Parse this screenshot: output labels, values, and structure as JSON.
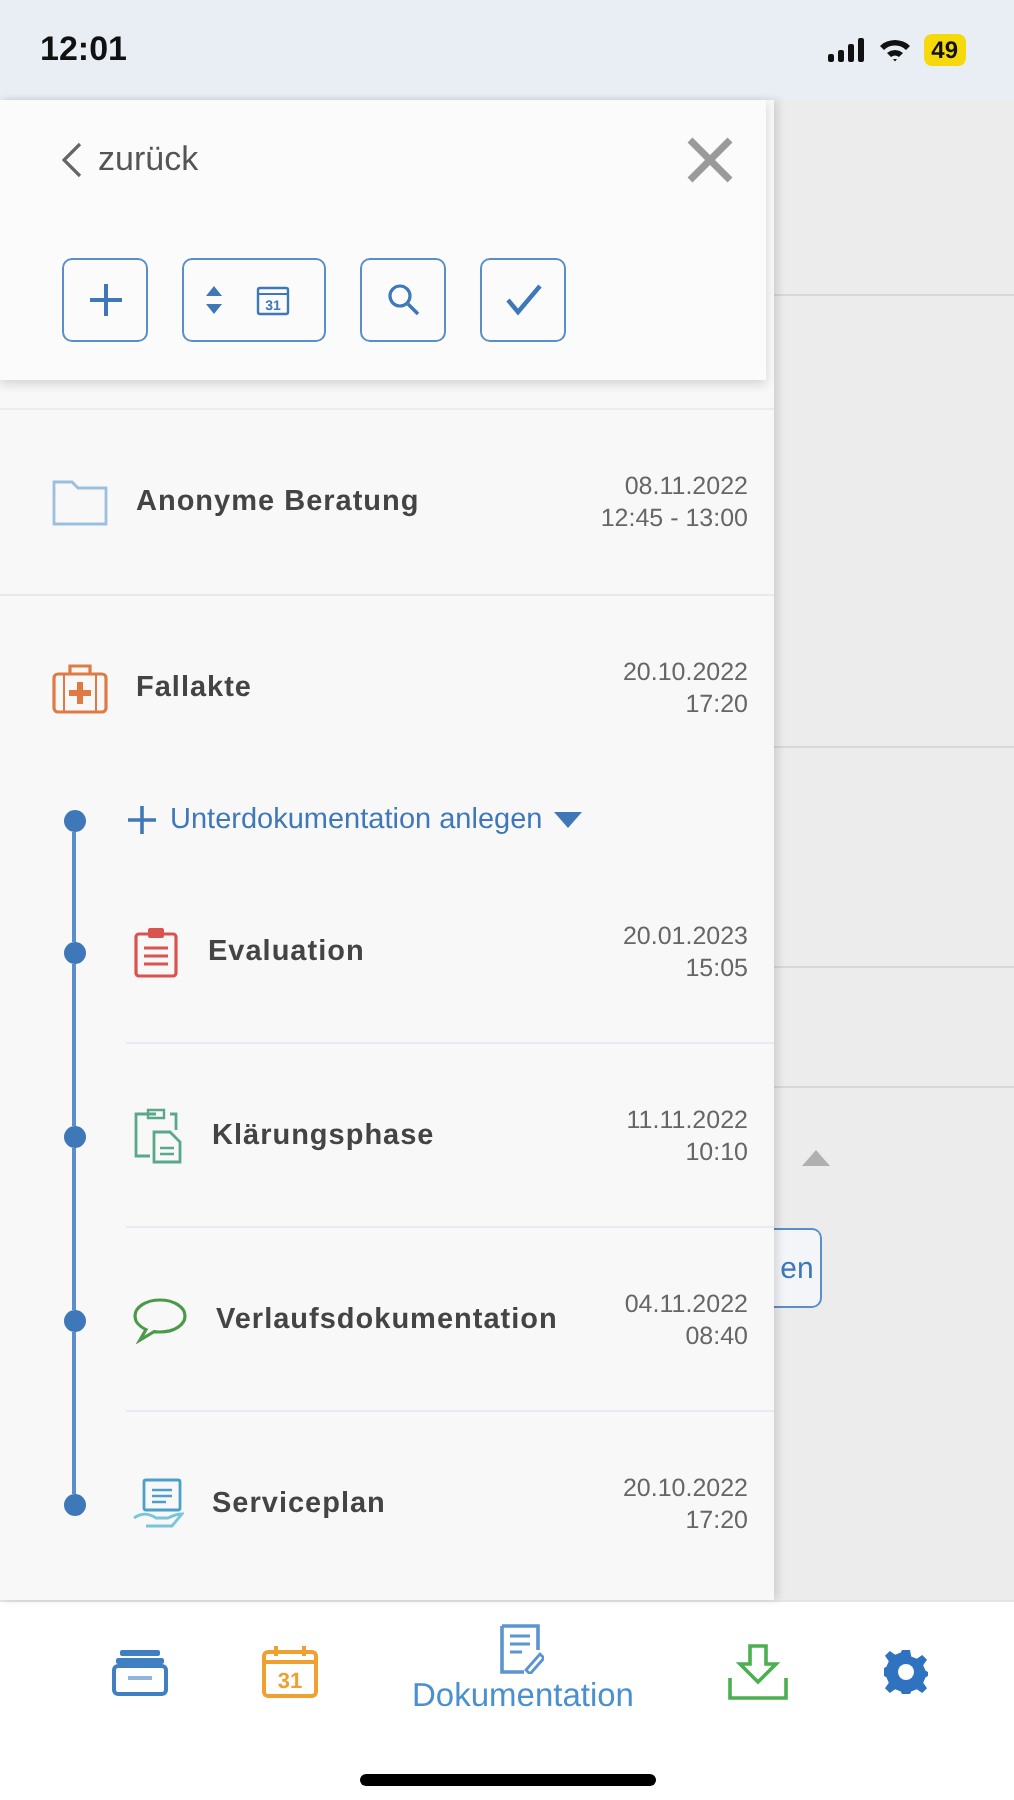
{
  "status_bar": {
    "time": "12:01",
    "battery": "49"
  },
  "drawer": {
    "back_label": "zurück",
    "toolbar": [
      {
        "kind": "add"
      },
      {
        "kind": "sort_date",
        "text": "31"
      },
      {
        "kind": "search"
      },
      {
        "kind": "check"
      }
    ],
    "documents": [
      {
        "kind": "folder",
        "title": "Anonyme Beratung",
        "date": "08.11.2022",
        "time": "12:45 - 13:00"
      },
      {
        "kind": "case",
        "title": "Fallakte",
        "date": "20.10.2022",
        "time": "17:20",
        "add_label": "Unterdokumentation anlegen",
        "children": [
          {
            "kind": "evaluation",
            "title": "Evaluation",
            "date": "20.01.2023",
            "time": "15:05"
          },
          {
            "kind": "clarification",
            "title": "Klärungsphase",
            "date": "11.11.2022",
            "time": "10:10"
          },
          {
            "kind": "progress",
            "title": "Verlaufsdokumentation",
            "date": "04.11.2022",
            "time": "08:40"
          },
          {
            "kind": "serviceplan",
            "title": "Serviceplan",
            "date": "20.10.2022",
            "time": "17:20"
          }
        ]
      }
    ]
  },
  "background": {
    "button_fragment": "en"
  },
  "nav": [
    {
      "kind": "archive",
      "selected": false
    },
    {
      "kind": "calendar",
      "text": "31",
      "selected": false
    },
    {
      "kind": "documentation",
      "label": "Dokumentation",
      "selected": true
    },
    {
      "kind": "download",
      "selected": false
    },
    {
      "kind": "settings",
      "selected": false
    }
  ]
}
